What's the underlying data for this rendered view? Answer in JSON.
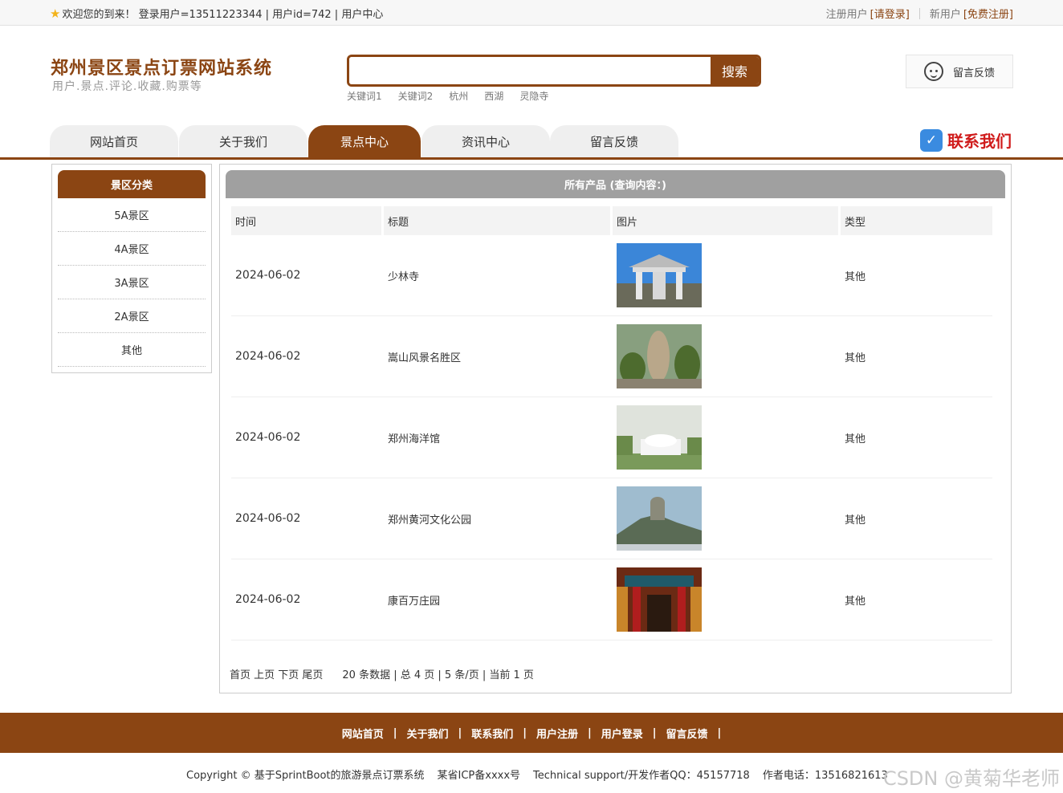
{
  "topbar": {
    "welcome": "欢迎您的到来！ 登录用户=13511223344 | 用户id=742 | 用户中心",
    "reg_prefix": "注册用户",
    "login": "[请登录]",
    "new_prefix": "新用户",
    "register": "[免费注册]"
  },
  "header": {
    "title": "郑州景区景点订票网站系统",
    "subtitle": "用户.景点.评论.收藏.购票等",
    "search_placeholder": "",
    "search_button": "搜索",
    "keywords": [
      "关键词1",
      "关键词2",
      "杭州",
      "西湖",
      "灵隐寺"
    ],
    "feedback": "留言反馈"
  },
  "nav": {
    "tabs": [
      "网站首页",
      "关于我们",
      "景点中心",
      "资讯中心",
      "留言反馈"
    ],
    "contact": "联系我们"
  },
  "sidebar": {
    "title": "景区分类",
    "items": [
      "5A景区",
      "4A景区",
      "3A景区",
      "2A景区",
      "其他"
    ]
  },
  "main": {
    "title": "所有产品 (查询内容：)",
    "headers": [
      "时间",
      "标题",
      "图片",
      "类型"
    ],
    "rows": [
      {
        "date": "2024-06-02",
        "title": "少林寺",
        "type": "其他"
      },
      {
        "date": "2024-06-02",
        "title": "嵩山风景名胜区",
        "type": "其他"
      },
      {
        "date": "2024-06-02",
        "title": "郑州海洋馆",
        "type": "其他"
      },
      {
        "date": "2024-06-02",
        "title": "郑州黄河文化公园",
        "type": "其他"
      },
      {
        "date": "2024-06-02",
        "title": "康百万庄园",
        "type": "其他"
      }
    ],
    "pager_links": "首页 上页 下页 尾页",
    "pager_info": "20 条数据 | 总 4 页 | 5 条/页 | 当前 1 页"
  },
  "footer": {
    "links": [
      "网站首页",
      "关于我们",
      "联系我们",
      "用户注册",
      "用户登录",
      "留言反馈"
    ],
    "copyright": "Copyright © 基于SprintBoot的旅游景点订票系统",
    "icp": "某省ICP备xxxx号",
    "support": "Technical support/开发作者QQ：45157718",
    "phone": "作者电话：13516821613",
    "watermark": "CSDN @黄菊华老师"
  }
}
